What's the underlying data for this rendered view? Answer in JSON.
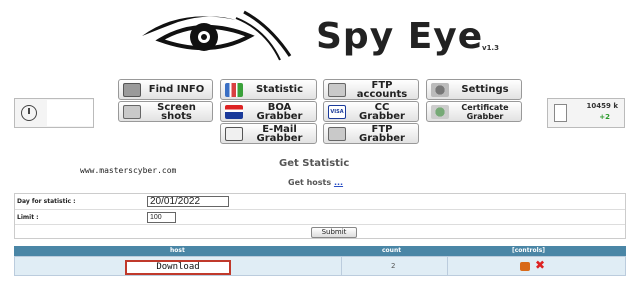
{
  "header": {
    "title": "Spy Eye",
    "version": "v1.3"
  },
  "nav": {
    "find_info": "Find INFO",
    "statistic": "Statistic",
    "ftp_accounts": "FTP\naccounts",
    "settings": "Settings",
    "screenshots": "Screen\nshots",
    "boa_grabber": "BOA\nGrabber",
    "cc_grabber": "CC\nGrabber",
    "certificate_grabber": "Certificate\nGrabber",
    "email_grabber": "E-Mail\nGrabber",
    "ftp_grabber": "FTP\nGrabber"
  },
  "stats_box": {
    "size": "10459 k",
    "delta": "+2"
  },
  "watermark": "www.masterscyber.com",
  "get_statistic": "Get Statistic",
  "get_hosts": "Get hosts",
  "get_hosts_link": "...",
  "form": {
    "day_label": "Day for statistic :",
    "day_value": "20/01/2022",
    "limit_label": "Limit :",
    "limit_value": "100",
    "submit_label": "Submit"
  },
  "results": {
    "headers": [
      "host",
      "count",
      "[controls]"
    ],
    "rows": [
      {
        "host": "Download",
        "count": "2"
      }
    ]
  },
  "colors": {
    "table_header": "#4a86a6",
    "row_bg": "#e0edf5",
    "highlight_border": "#c0392b",
    "link": "#2a4fc4"
  }
}
